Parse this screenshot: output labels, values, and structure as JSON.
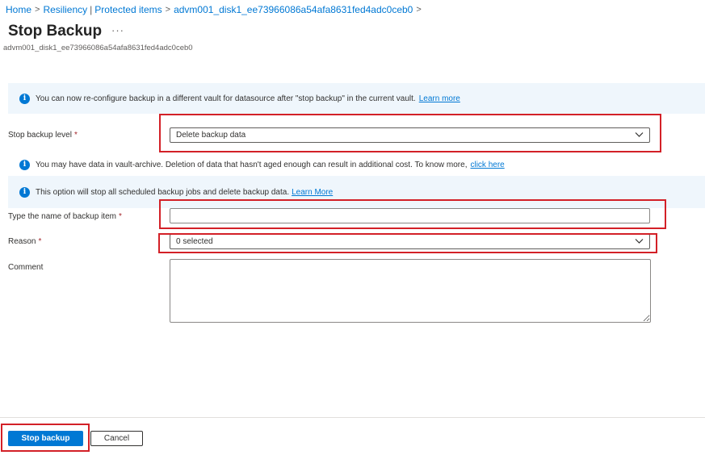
{
  "breadcrumb": {
    "home": "Home",
    "resiliency": "Resiliency",
    "pipe": "|",
    "protected_items": "Protected items",
    "item": "advm001_disk1_ee73966086a54afa8631fed4adc0ceb0"
  },
  "header": {
    "title": "Stop Backup",
    "more": "···",
    "subtitle": "advm001_disk1_ee73966086a54afa8631fed4adc0ceb0"
  },
  "banners": {
    "reconfigure": {
      "text": "You can now re-configure backup in a different vault for datasource after \"stop backup\" in the current vault.",
      "link": "Learn more"
    },
    "vault_archive": {
      "text": "You may have data in vault-archive. Deletion of data that hasn't aged enough can result in additional cost. To know more,",
      "link": "click here"
    },
    "stop_option": {
      "text": "This option will stop all scheduled backup jobs and delete backup data.",
      "link": "Learn More"
    }
  },
  "form": {
    "stop_level": {
      "label": "Stop backup level",
      "value": "Delete backup data"
    },
    "item_name": {
      "label": "Type the name of backup item",
      "value": ""
    },
    "reason": {
      "label": "Reason",
      "value": "0 selected"
    },
    "comment": {
      "label": "Comment",
      "value": ""
    },
    "required_mark": "*"
  },
  "footer": {
    "stop_button": "Stop backup",
    "cancel_button": "Cancel"
  },
  "colors": {
    "accent": "#0078d4",
    "highlight": "#d32027",
    "banner_bg": "#eff6fc",
    "required": "#a4262c"
  },
  "icons": {
    "info": "info-icon",
    "chevron": "chevron-down-icon",
    "breadcrumb_sep": "chevron-right-icon"
  }
}
